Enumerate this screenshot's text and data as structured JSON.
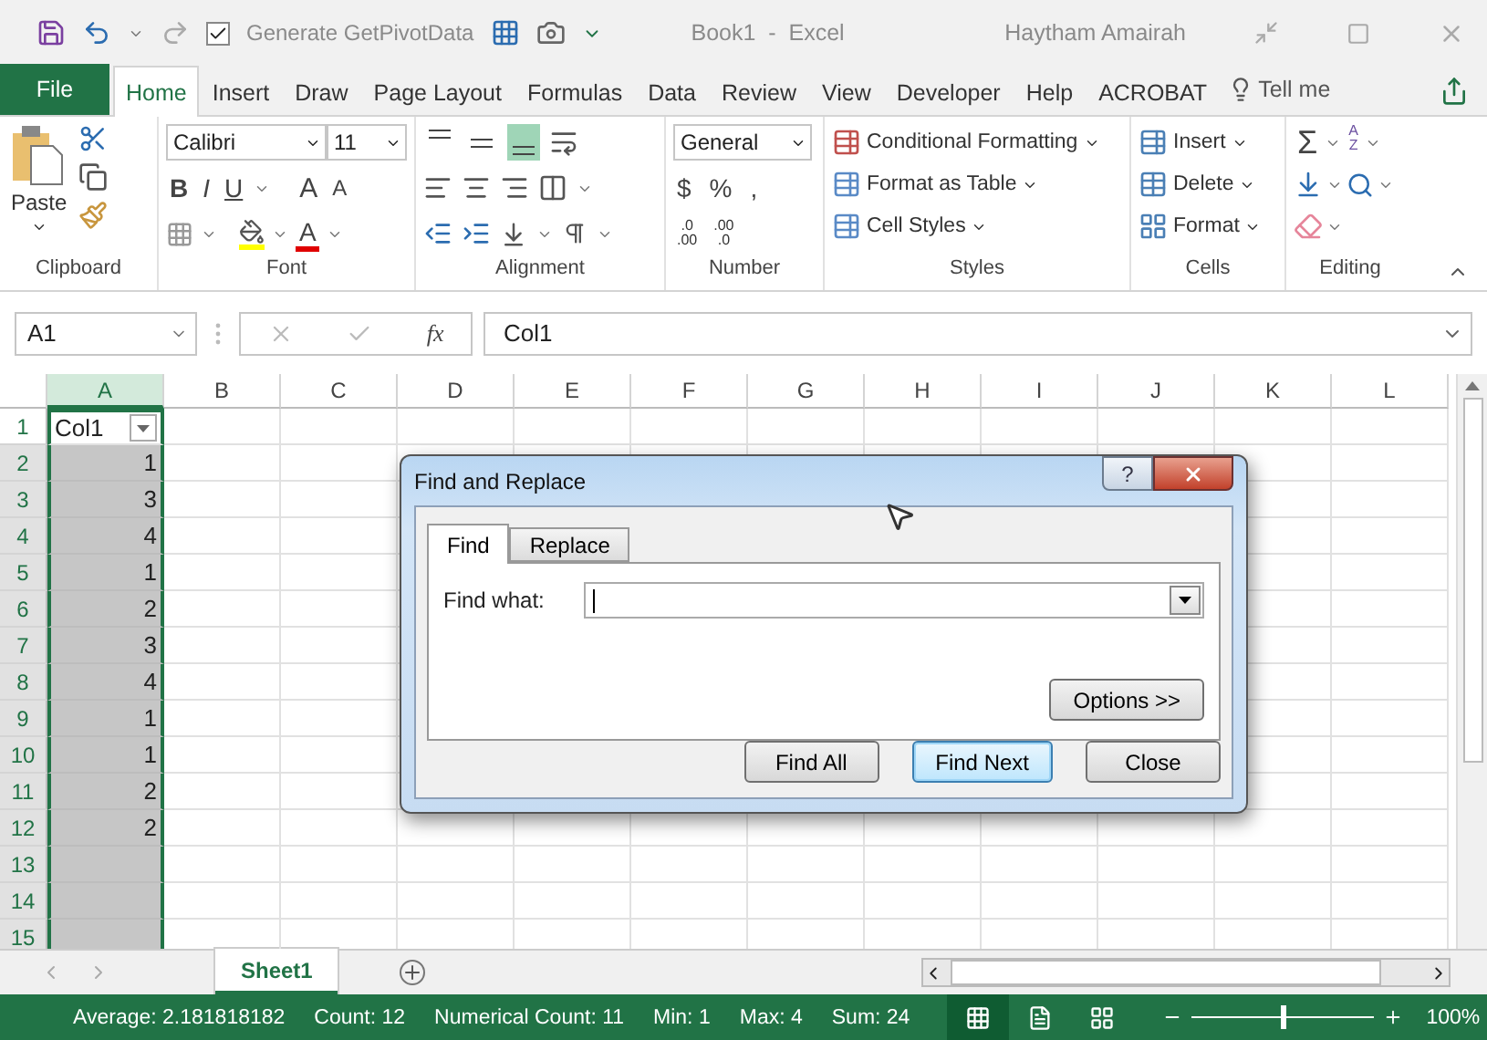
{
  "title_bar": {
    "generate_pivot": {
      "label": "Generate GetPivotData",
      "checked": true
    },
    "title": "Book1  -  Excel",
    "user": "Haytham Amairah"
  },
  "file_tab": "File",
  "ribbon_tabs": [
    {
      "label": "Home",
      "selected": true
    },
    {
      "label": "Insert",
      "selected": false
    },
    {
      "label": "Draw",
      "selected": false
    },
    {
      "label": "Page Layout",
      "selected": false
    },
    {
      "label": "Formulas",
      "selected": false
    },
    {
      "label": "Data",
      "selected": false
    },
    {
      "label": "Review",
      "selected": false
    },
    {
      "label": "View",
      "selected": false
    },
    {
      "label": "Developer",
      "selected": false
    },
    {
      "label": "Help",
      "selected": false
    },
    {
      "label": "ACROBAT",
      "selected": false
    }
  ],
  "tell_me": "Tell me",
  "ribbon": {
    "clipboard": {
      "label": "Clipboard",
      "paste": "Paste"
    },
    "font": {
      "label": "Font",
      "font_name": "Calibri",
      "font_size": "11",
      "style_buttons": [
        "B",
        "I",
        "U"
      ],
      "size_buttons": [
        "A",
        "A"
      ],
      "color_button": "A"
    },
    "alignment": {
      "label": "Alignment",
      "vertical": [
        {
          "selected": false
        },
        {
          "selected": false
        },
        {
          "selected": true
        }
      ]
    },
    "number": {
      "label": "Number",
      "format": "General",
      "buttons": [
        "$",
        "%",
        ","
      ],
      "decimal_buttons": [
        {
          "top": ".0",
          "bottom": ".00"
        },
        {
          "top": ".00",
          "bottom": ".0"
        }
      ]
    },
    "styles": {
      "label": "Styles",
      "items": [
        "Conditional Formatting",
        "Format as Table",
        "Cell Styles"
      ]
    },
    "cells": {
      "label": "Cells",
      "items": [
        "Insert",
        "Delete",
        "Format"
      ]
    },
    "editing": {
      "label": "Editing",
      "sum": "Σ",
      "sort": [
        "A",
        "Z"
      ]
    }
  },
  "formula_bar": {
    "name_box": "A1",
    "fx": "fx",
    "value": "Col1"
  },
  "grid": {
    "columns": [
      {
        "label": "A",
        "selected": true
      },
      {
        "label": "B",
        "selected": false
      },
      {
        "label": "C",
        "selected": false
      },
      {
        "label": "D",
        "selected": false
      },
      {
        "label": "E",
        "selected": false
      },
      {
        "label": "F",
        "selected": false
      },
      {
        "label": "G",
        "selected": false
      },
      {
        "label": "H",
        "selected": false
      },
      {
        "label": "I",
        "selected": false
      },
      {
        "label": "J",
        "selected": false
      },
      {
        "label": "K",
        "selected": false
      },
      {
        "label": "L",
        "selected": false
      }
    ],
    "rows": [
      {
        "number": "1",
        "value": "Col1",
        "kind": "header",
        "selected": false
      },
      {
        "number": "2",
        "value": "1",
        "kind": "number",
        "selected": true
      },
      {
        "number": "3",
        "value": "3",
        "kind": "number",
        "selected": true
      },
      {
        "number": "4",
        "value": "4",
        "kind": "number",
        "selected": true
      },
      {
        "number": "5",
        "value": "1",
        "kind": "number",
        "selected": true
      },
      {
        "number": "6",
        "value": "2",
        "kind": "number",
        "selected": true
      },
      {
        "number": "7",
        "value": "3",
        "kind": "number",
        "selected": true
      },
      {
        "number": "8",
        "value": "4",
        "kind": "number",
        "selected": true
      },
      {
        "number": "9",
        "value": "1",
        "kind": "number",
        "selected": true
      },
      {
        "number": "10",
        "value": "1",
        "kind": "number",
        "selected": true
      },
      {
        "number": "11",
        "value": "2",
        "kind": "number",
        "selected": true
      },
      {
        "number": "12",
        "value": "2",
        "kind": "number",
        "selected": true
      },
      {
        "number": "13",
        "kind": "empty",
        "selected": true
      },
      {
        "number": "14",
        "kind": "empty",
        "selected": true
      },
      {
        "number": "15",
        "kind": "empty",
        "selected": true
      }
    ]
  },
  "dialog": {
    "title": "Find and Replace",
    "help": "?",
    "tabs": [
      {
        "label": "Find",
        "selected": true
      },
      {
        "label": "Replace",
        "selected": false
      }
    ],
    "find_what": {
      "label": "Find what:"
    },
    "options_button": "Options >>",
    "buttons": [
      {
        "label": "Find All",
        "default": false
      },
      {
        "label": "Find Next",
        "default": true
      },
      {
        "label": "Close",
        "default": false
      }
    ]
  },
  "sheet_tabs": [
    {
      "label": "Sheet1",
      "selected": true
    }
  ],
  "status_bar": {
    "stats": [
      "Average: 2.181818182",
      "Count: 12",
      "Numerical Count: 11",
      "Min: 1",
      "Max: 4",
      "Sum: 24"
    ],
    "views": [
      {
        "kind": "normal",
        "selected": true
      },
      {
        "kind": "page_layout",
        "selected": false
      },
      {
        "kind": "page_break",
        "selected": false
      }
    ],
    "zoom": {
      "level": 0.5,
      "reading": "100%"
    }
  }
}
